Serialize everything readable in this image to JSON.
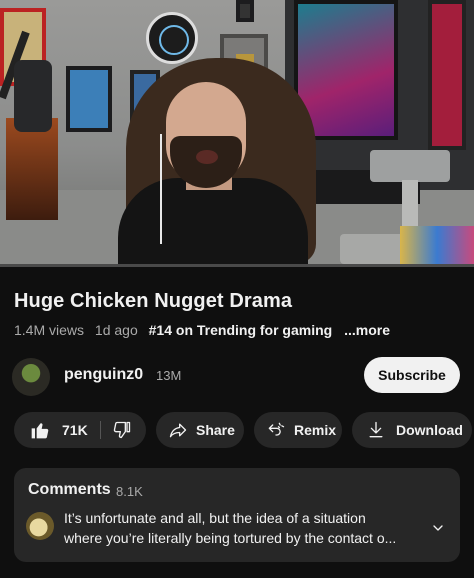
{
  "player": {
    "progress": 0.0
  },
  "video": {
    "title": "Huge Chicken Nugget Drama",
    "views": "1.4M views",
    "age": "1d ago",
    "trending": "#14 on Trending for gaming",
    "more": "...more"
  },
  "channel": {
    "name": "penguinz0",
    "subscribers": "13M",
    "subscribe_label": "Subscribe"
  },
  "actions": {
    "like_count": "71K",
    "share_label": "Share",
    "remix_label": "Remix",
    "download_label": "Download"
  },
  "comments": {
    "title": "Comments",
    "count": "8.1K",
    "top_comment_line1": "It’s unfortunate and all, but the idea of a situation",
    "top_comment_line2": "where you’re literally being tortured by the contact o..."
  },
  "icons": {
    "like": "thumbs-up-icon",
    "dislike": "thumbs-down-icon",
    "share": "share-arrow-icon",
    "remix": "remix-icon",
    "download": "download-icon",
    "expand": "chevron-down-icon"
  },
  "colors": {
    "background": "#0f0f0f",
    "pill": "#272727",
    "text_secondary": "#aaaaaa",
    "subscribe_bg": "#f1f1f1",
    "progress_red": "#ff0000"
  }
}
